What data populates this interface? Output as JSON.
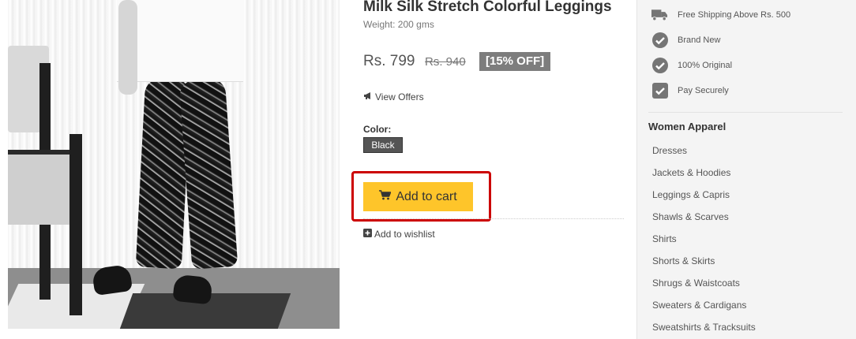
{
  "product": {
    "title": "Milk Silk Stretch Colorful Leggings",
    "weight": "Weight: 200 gms",
    "price": "Rs. 799",
    "old_price": "Rs. 940",
    "discount": "[15% OFF]",
    "view_offers": "View Offers",
    "color_label": "Color:",
    "color_value": "Black",
    "add_to_cart": "Add to cart",
    "add_to_wishlist": "Add to wishlist"
  },
  "sidebar": {
    "features": [
      {
        "icon": "truck-icon",
        "label": "Free Shipping Above Rs. 500"
      },
      {
        "icon": "check-circle-icon",
        "label": "Brand New"
      },
      {
        "icon": "check-circle-icon",
        "label": "100% Original"
      },
      {
        "icon": "check-square-icon",
        "label": "Pay Securely"
      }
    ],
    "category_title": "Women Apparel",
    "categories": [
      "Dresses",
      "Jackets & Hoodies",
      "Leggings & Capris",
      "Shawls & Scarves",
      "Shirts",
      "Shorts & Skirts",
      "Shrugs & Waistcoats",
      "Sweaters & Cardigans",
      "Sweatshirts & Tracksuits"
    ]
  },
  "colors": {
    "add_to_cart_bg": "#fec52a",
    "discount_bg": "#7d7d7d",
    "highlight_border": "#cc0000",
    "sidebar_bg": "#f4f4f4",
    "icon_color": "#757575"
  }
}
